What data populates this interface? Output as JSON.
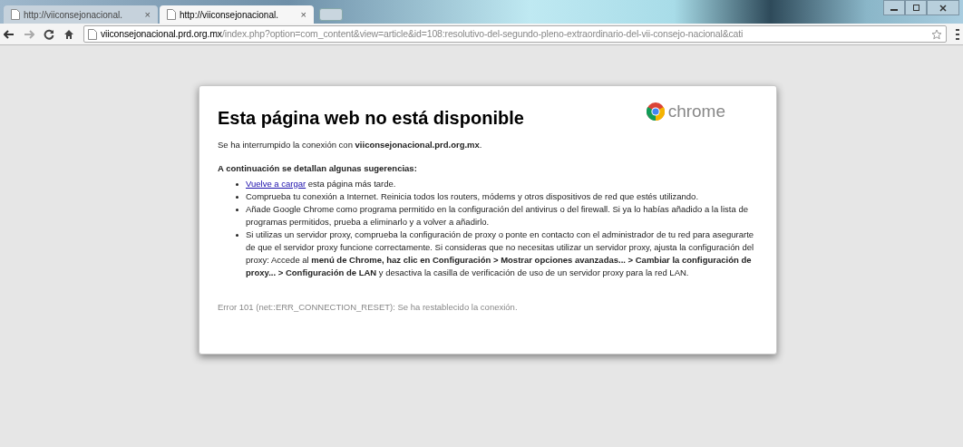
{
  "tabs": [
    {
      "title": "http://viiconsejonacional.",
      "selected": false,
      "close": "×"
    },
    {
      "title": "http://viiconsejonacional.",
      "selected": true,
      "close": "×"
    }
  ],
  "address": {
    "host": "viiconsejonacional.prd.org.mx",
    "path": "/index.php?option=com_content&view=article&id=108:resolutivo-del-segundo-pleno-extraordinario-del-vii-consejo-nacional&cati"
  },
  "error_page": {
    "title": "Esta página web no está disponible",
    "brand": "chrome",
    "intro": "Se ha interrumpido la conexión con **viiconsejonacional.prd.org.mx**.",
    "suggestions_heading": "A continuación se detallan algunas sugerencias:",
    "suggestions": [
      {
        "link": "Vuelve a cargar",
        "text": " esta página más tarde."
      },
      {
        "text": "Comprueba tu conexión a Internet. Reinicia todos los routers, módems y otros dispositivos de red que estés utilizando."
      },
      {
        "text": "Añade Google Chrome como programa permitido en la configuración del antivirus o del firewall. Si ya lo habías añadido a la lista de programas permitidos, prueba a eliminarlo y a volver a añadirlo."
      },
      {
        "text": "Si utilizas un servidor proxy, comprueba la configuración de proxy o ponte en contacto con el administrador de tu red para asegurarte de que el servidor proxy funcione correctamente. Si consideras que no necesitas utilizar un servidor proxy, ajusta la configuración del proxy: Accede al **menú de Chrome, haz clic en Configuración > Mostrar opciones avanzadas... > Cambiar la configuración de proxy... > Configuración de LAN** y desactiva la casilla de verificación de uso de un servidor proxy para la red LAN."
      }
    ],
    "error_code": "Error 101 (net::ERR_CONNECTION_RESET): Se ha restablecido la conexión."
  }
}
